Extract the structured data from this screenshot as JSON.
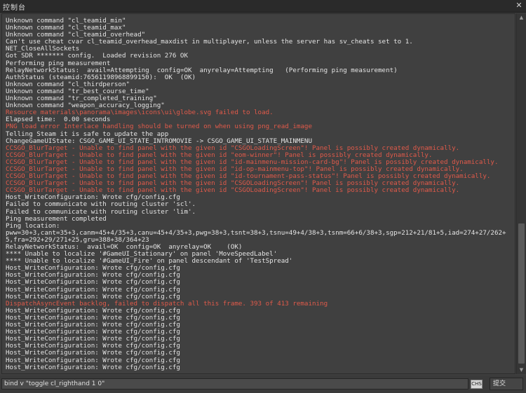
{
  "window": {
    "title": "控制台",
    "close_glyph": "✕"
  },
  "log_lines": [
    {
      "text": "Unknown command \"cl_teamid_min\"",
      "red": false
    },
    {
      "text": "Unknown command \"cl_teamid_max\"",
      "red": false
    },
    {
      "text": "Unknown command \"cl_teamid_overhead\"",
      "red": false
    },
    {
      "text": "Can't use cheat cvar cl_teamid_overhead_maxdist in multiplayer, unless the server has sv_cheats set to 1.",
      "red": false
    },
    {
      "text": "NET_CloseAllSockets",
      "red": false
    },
    {
      "text": "Got SDR ******* config.  Loaded revision 276 OK",
      "red": false
    },
    {
      "text": "Performing ping measurement",
      "red": false
    },
    {
      "text": "RelayNetworkStatus:  avail=Attempting  config=OK  anyrelay=Attempting   (Performing ping measurement)",
      "red": false
    },
    {
      "text": "AuthStatus (steamid:76561198968899150):  OK  (OK)",
      "red": false
    },
    {
      "text": "Unknown command \"cl_thirdperson\"",
      "red": false
    },
    {
      "text": "Unknown command \"tr_best_course_time\"",
      "red": false
    },
    {
      "text": "Unknown command \"tr_completed_training\"",
      "red": false
    },
    {
      "text": "Unknown command \"weapon_accuracy_logging\"",
      "red": false
    },
    {
      "text": "Resource materials\\panorama\\images\\icons\\ui\\globe.svg failed to load.",
      "red": true
    },
    {
      "text": "Elapsed time:  0.00 seconds",
      "red": false
    },
    {
      "text": "PNG load error Interlace handling should be turned on when using png_read_image",
      "red": true
    },
    {
      "text": "Telling Steam it is safe to update the app",
      "red": false
    },
    {
      "text": "ChangeGameUIState: CSGO_GAME_UI_STATE_INTROMOVIE -> CSGO_GAME_UI_STATE_MAINMENU",
      "red": false
    },
    {
      "text": "CCSGO_BlurTarget - Unable to find panel with the given id \"CSGOLoadingScreen\"! Panel is possibly created dynamically.",
      "red": true
    },
    {
      "text": "CCSGO_BlurTarget - Unable to find panel with the given id \"eom-winner\"! Panel is possibly created dynamically.",
      "red": true
    },
    {
      "text": "CCSGO_BlurTarget - Unable to find panel with the given id \"id-mainmenu-mission-card-bg\"! Panel is possibly created dynamically.",
      "red": true
    },
    {
      "text": "CCSGO_BlurTarget - Unable to find panel with the given id \"id-op-mainmenu-top\"! Panel is possibly created dynamically.",
      "red": true
    },
    {
      "text": "CCSGO_BlurTarget - Unable to find panel with the given id \"id-tournament-pass-status\"! Panel is possibly created dynamically.",
      "red": true
    },
    {
      "text": "CCSGO_BlurTarget - Unable to find panel with the given id \"CSGOLoadingScreen\"! Panel is possibly created dynamically.",
      "red": true
    },
    {
      "text": "CCSGO_BlurTarget - Unable to find panel with the given id \"CSGOLoadingScreen\"! Panel is possibly created dynamically.",
      "red": true
    },
    {
      "text": "Host_WriteConfiguration: Wrote cfg/config.cfg",
      "red": false
    },
    {
      "text": "Failed to communicate with routing cluster 'scl'.",
      "red": false
    },
    {
      "text": "Failed to communicate with routing cluster 'lim'.",
      "red": false
    },
    {
      "text": "Ping measurement completed",
      "red": false
    },
    {
      "text": "Ping location:",
      "red": false
    },
    {
      "text": "pww=30+3,cant=35+3,canm=45+4/35+3,canu=45+4/35+3,pwg=38+3,tsnt=38+3,tsnu=49+4/38+3,tsnm=66+6/38+3,sgp=212+21/81+5,iad=274+27/262+5,fra=292+29/271+25,gru=388+38/364+23",
      "red": false
    },
    {
      "text": "RelayNetworkStatus:  avail=OK  config=OK  anyrelay=OK    (OK)",
      "red": false
    },
    {
      "text": "**** Unable to localize '#GameUI_Stationary' on panel 'MoveSpeedLabel'",
      "red": false
    },
    {
      "text": "**** Unable to localize '#GameUI_Fire' on panel descendant of 'TestSpread'",
      "red": false
    },
    {
      "text": "Host_WriteConfiguration: Wrote cfg/config.cfg",
      "red": false
    },
    {
      "text": "Host_WriteConfiguration: Wrote cfg/config.cfg",
      "red": false
    },
    {
      "text": "Host_WriteConfiguration: Wrote cfg/config.cfg",
      "red": false
    },
    {
      "text": "Host_WriteConfiguration: Wrote cfg/config.cfg",
      "red": false
    },
    {
      "text": "Host_WriteConfiguration: Wrote cfg/config.cfg",
      "red": false
    },
    {
      "text": "DispatchAsyncEvent backlog, failed to dispatch all this frame. 393 of 413 remaining",
      "red": true
    },
    {
      "text": "Host_WriteConfiguration: Wrote cfg/config.cfg",
      "red": false
    },
    {
      "text": "Host_WriteConfiguration: Wrote cfg/config.cfg",
      "red": false
    },
    {
      "text": "Host_WriteConfiguration: Wrote cfg/config.cfg",
      "red": false
    },
    {
      "text": "Host_WriteConfiguration: Wrote cfg/config.cfg",
      "red": false
    },
    {
      "text": "Host_WriteConfiguration: Wrote cfg/config.cfg",
      "red": false
    },
    {
      "text": "Host_WriteConfiguration: Wrote cfg/config.cfg",
      "red": false
    },
    {
      "text": "Host_WriteConfiguration: Wrote cfg/config.cfg",
      "red": false
    },
    {
      "text": "Host_WriteConfiguration: Wrote cfg/config.cfg",
      "red": false
    },
    {
      "text": "Host_WriteConfiguration: Wrote cfg/config.cfg",
      "red": false
    }
  ],
  "colors": {
    "normal_text": "#e4e4e4",
    "error_text": "#e05a4a",
    "background": "#404040"
  },
  "input": {
    "value": "bind v \"toggle cl_righthand 1 0\""
  },
  "ime_indicator": "CHS",
  "submit_label": "提交"
}
